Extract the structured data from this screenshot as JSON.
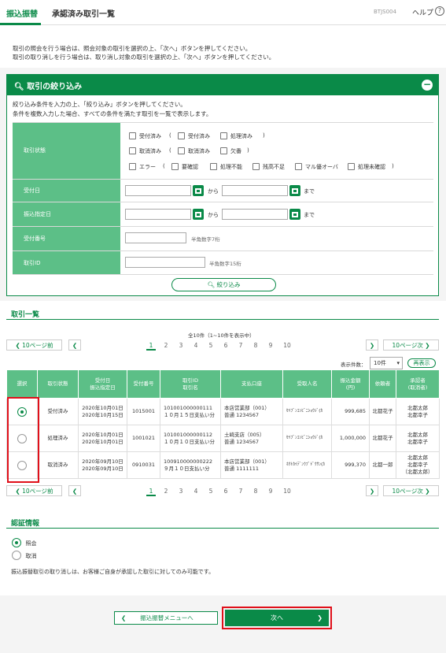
{
  "header": {
    "tab": "振込振替",
    "title": "承認済み取引一覧",
    "screen_code": "BTJS004",
    "help": "ヘルプ",
    "help_icon": "?"
  },
  "intro": {
    "line1": "取引の照会を行う場合は、照会対象の取引を選択の上、「次へ」ボタンを押してください。",
    "line2": "取引の取り消しを行う場合は、取り消し対象の取引を選択の上、「次へ」ボタンを押してください。"
  },
  "filter": {
    "title": "取引の絞り込み",
    "collapse": "−",
    "desc1": "絞り込み条件を入力の上、「絞り込み」ボタンを押してください。",
    "desc2": "条件を複数入力した場合、すべての条件を満たす取引を一覧で表示します。",
    "status_label": "取引状態",
    "status_row1": [
      "受付済み",
      "(",
      "受付済み",
      "処理済み",
      ")"
    ],
    "status_row2": [
      "取消済み",
      "(",
      "取消済み",
      "欠番",
      ")"
    ],
    "status_row3": [
      "エラー",
      "(",
      "要確認",
      "処理不能",
      "残高不足",
      "マル優オーバ",
      "処理未確認",
      ")"
    ],
    "received_date_label": "受付日",
    "transfer_date_label": "振込指定日",
    "from": "から",
    "to": "まで",
    "receipt_no_label": "受付番号",
    "receipt_no_hint": "半角数字7桁",
    "txn_id_label": "取引ID",
    "txn_id_hint": "半角数字15桁",
    "submit": "絞り込み"
  },
  "list": {
    "title": "取引一覧",
    "count": "全10件（1~10件を表示中）",
    "prev10": "10ページ前",
    "next10": "10ページ次",
    "pages": [
      "1",
      "2",
      "3",
      "4",
      "5",
      "6",
      "7",
      "8",
      "9",
      "10"
    ],
    "current_page": "1",
    "per_page_label": "表示件数：",
    "per_page_value": "10件",
    "redisplay": "再表示",
    "columns": [
      "選択",
      "取引状態",
      "受付日\n振込指定日",
      "受付番号",
      "取引ID\n取引名",
      "支払口座",
      "受取人名",
      "振込金額\n(円)",
      "依頼者",
      "承認者\n(取消者)"
    ],
    "rows": [
      {
        "selected": true,
        "status": "受付済み",
        "date1": "2020年10月01日",
        "date2": "2020年10月15日",
        "receipt": "1015001",
        "txn_id": "101001000000111",
        "txn_name": "１０月１５日支払い分",
        "acct1": "本店営業部（001）",
        "acct2": "普通 1234567",
        "payee": "ｾｲﾌﾞﾝｺﾝﾋﾞﾆｼｮｳｼﾞ(ｶ",
        "amount": "999,685",
        "requester": "北都花子",
        "approver": [
          "北都太郎",
          "北都幸子"
        ]
      },
      {
        "selected": false,
        "status": "処理済み",
        "date1": "2020年10月01日",
        "date2": "2020年10月01日",
        "receipt": "1001021",
        "txn_id": "101001000000112",
        "txn_name": "１０月１０日支払い分",
        "acct1": "土崎支店（005）",
        "acct2": "普通 1234567",
        "payee": "ｾｲﾌﾞﾝｺﾝﾋﾞﾆｼｮｳｼﾞ(ｶ",
        "amount": "1,000,000",
        "requester": "北都花子",
        "approver": [
          "北都太郎",
          "北都幸子"
        ]
      },
      {
        "selected": false,
        "status": "取消済み",
        "date1": "2020年09月10日",
        "date2": "2020年09月10日",
        "receipt": "0910031",
        "txn_id": "100910000000222",
        "txn_name": "９月１０日支払い分",
        "acct1": "本店営業部（001）",
        "acct2": "普通 1111111",
        "payee": "ﾎｸﾄｶｲﾃﾞﾝｳﾌﾞﾄﾞｳｻﾝ(ｶ",
        "amount": "999,370",
        "requester": "北都一郎",
        "approver": [
          "北都太郎",
          "北都幸子",
          "（北都太郎）"
        ]
      }
    ]
  },
  "auth": {
    "title": "認証情報",
    "opt1": "照会",
    "opt2": "取消",
    "note": "振込振替取引の取り消しは、お客様ご自身が承認した取引に対してのみ可能です。"
  },
  "footer": {
    "back": "振込振替メニューへ",
    "next": "次へ"
  }
}
